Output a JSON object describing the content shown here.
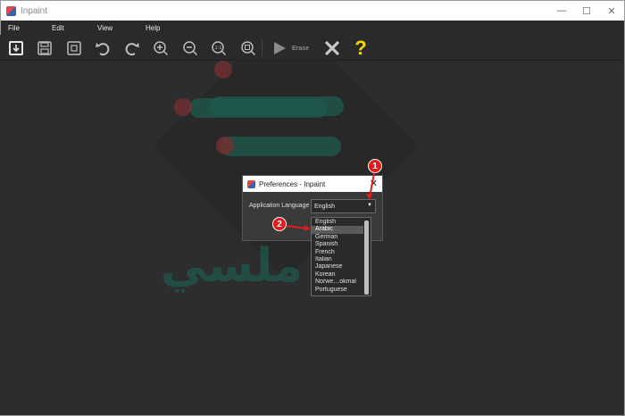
{
  "window": {
    "title": "Inpaint",
    "controls": {
      "minimize": "—",
      "maximize": "☐",
      "close": "✕"
    }
  },
  "menu": {
    "file": "File",
    "edit": "Edit",
    "view": "View",
    "help": "Help"
  },
  "toolbar": {
    "erase_label": "Erase",
    "help_symbol": "?"
  },
  "dialog": {
    "title": "Preferences - Inpaint",
    "close": "✕",
    "language_label": "Application Language",
    "language_value": "English",
    "languages": [
      "English",
      "Arabic",
      "German",
      "Spanish",
      "French",
      "Italian",
      "Japanese",
      "Korean",
      "Norwe…okmal",
      "Portuguese"
    ],
    "selected_language": "Arabic"
  },
  "annotations": {
    "marker1": "1",
    "marker2": "2"
  },
  "colors": {
    "marker": "#e31b1b",
    "help": "#f5d800",
    "background": "#2d2d2d"
  }
}
